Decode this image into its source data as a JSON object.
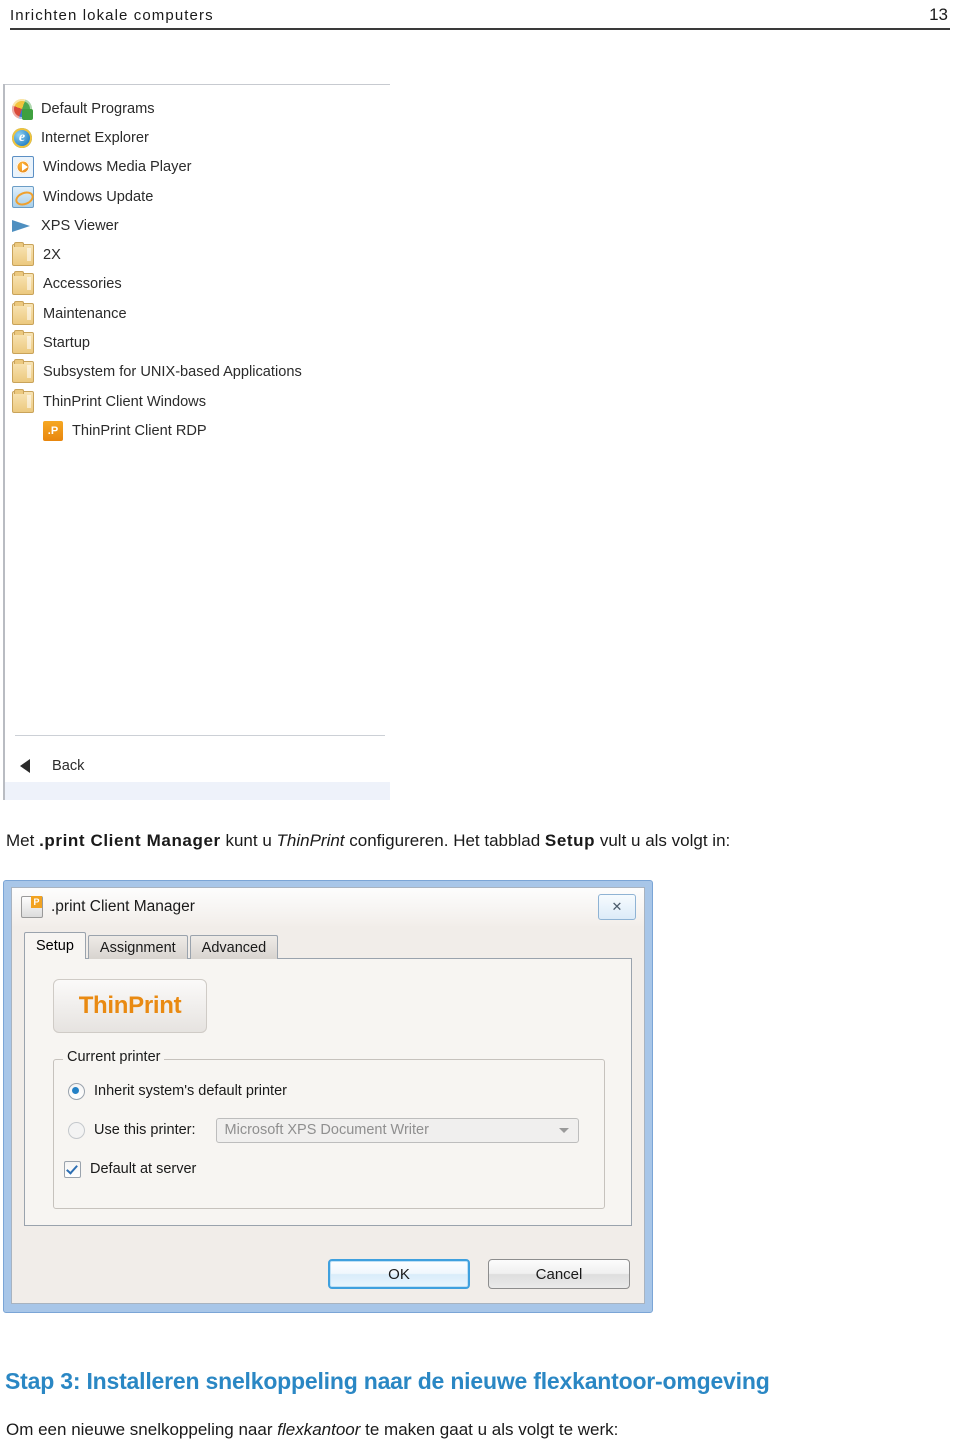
{
  "page_header": {
    "title": "Inrichten lokale computers",
    "page_number": "13"
  },
  "start_menu": {
    "items": [
      {
        "label": "Default Programs",
        "icon": "windows-flag-icon",
        "indent": false
      },
      {
        "label": "Internet Explorer",
        "icon": "internet-explorer-icon",
        "indent": false
      },
      {
        "label": "Windows Media Player",
        "icon": "media-player-icon",
        "indent": false
      },
      {
        "label": "Windows Update",
        "icon": "windows-update-icon",
        "indent": false
      },
      {
        "label": "XPS Viewer",
        "icon": "xps-viewer-icon",
        "indent": false
      },
      {
        "label": "2X",
        "icon": "folder-icon",
        "indent": false
      },
      {
        "label": "Accessories",
        "icon": "folder-icon",
        "indent": false
      },
      {
        "label": "Maintenance",
        "icon": "folder-icon",
        "indent": false
      },
      {
        "label": "Startup",
        "icon": "folder-icon",
        "indent": false
      },
      {
        "label": "Subsystem for UNIX-based Applications",
        "icon": "folder-icon",
        "indent": false
      },
      {
        "label": "ThinPrint Client Windows",
        "icon": "folder-icon",
        "indent": false
      },
      {
        "label": "ThinPrint Client RDP",
        "icon": "thinprint-rdp-icon",
        "indent": true
      }
    ],
    "back_label": "Back"
  },
  "paragraph_intro": {
    "part1": "Met ",
    "bold1": ".print Client Manager",
    "part2": " kunt u ",
    "italic1": "ThinPrint",
    "part3": " configureren. Het tabblad ",
    "bold2": "Setup",
    "part4": " vult u als volgt in:"
  },
  "dialog": {
    "title": ".print Client Manager",
    "close_label": "✕",
    "tabs": [
      {
        "label": "Setup",
        "active": true
      },
      {
        "label": "Assignment",
        "active": false
      },
      {
        "label": "Advanced",
        "active": false
      }
    ],
    "logo_text": "ThinPrint",
    "group": {
      "legend": "Current printer",
      "radio_inherit": "Inherit system's default printer",
      "radio_use_this": "Use this printer:",
      "printer_value": "Microsoft XPS Document Writer",
      "checkbox_default_at_server": "Default at server"
    },
    "buttons": {
      "ok": "OK",
      "cancel": "Cancel"
    }
  },
  "section_heading": "Stap 3: Installeren snelkoppeling naar de nieuwe flexkantoor-omgeving",
  "paragraph_closing": {
    "part1": "Om een nieuwe snelkoppeling naar ",
    "italic1": "flexkantoor",
    "part2": " te maken gaat u als volgt te werk:"
  },
  "colors": {
    "heading_blue": "#2a87c4",
    "thinprint_orange": "#e98a12",
    "dialog_frame_blue": "#a8c6e8",
    "radio_accent": "#2481c6"
  }
}
